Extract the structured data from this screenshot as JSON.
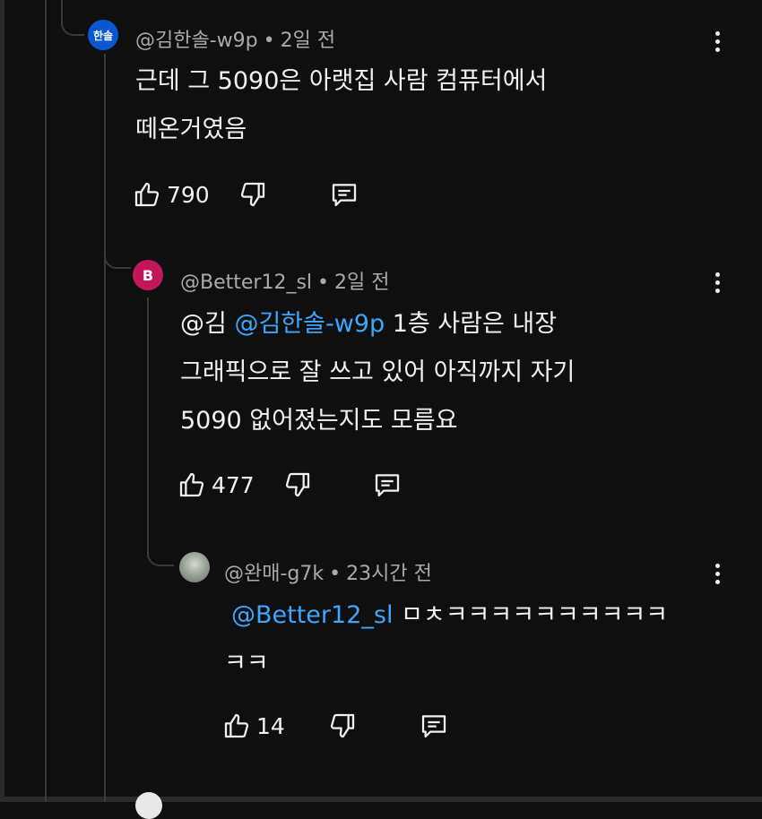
{
  "comments": [
    {
      "avatar_text": "한솔",
      "avatar_color": "#0b57d0",
      "author": "@김한솔-w9p",
      "time": "2일 전",
      "lines": [
        "근데 그 5090은 아랫집 사람 컴퓨터에서",
        "떼온거였음"
      ],
      "likes": "790"
    },
    {
      "avatar_text": "B",
      "avatar_color": "#c2185b",
      "author": "@Better12_sl",
      "time": "2일 전",
      "prefix": "@김 ",
      "mention": "@김한솔-w9p",
      "line1_rest": " 1층 사람은 내장",
      "lines": [
        "그래픽으로 잘 쓰고 있어 아직까지 자기",
        "5090 없어졌는지도 모름요"
      ],
      "likes": "477"
    },
    {
      "avatar_text": "",
      "avatar_color": "#8a9a8a",
      "author": "@완매-g7k",
      "time": "23시간 전",
      "mention": "@Better12_sl",
      "line1_rest": " ㅁㅊㅋㅋㅋㅋㅋㅋㅋㅋㅋㅋ",
      "lines": [
        "ㅋㅋ"
      ],
      "likes": "14"
    }
  ],
  "separator": "•",
  "icons": {
    "more": "more-vert-icon",
    "like": "thumb-up-icon",
    "dislike": "thumb-down-icon",
    "reply": "reply-comment-icon"
  }
}
